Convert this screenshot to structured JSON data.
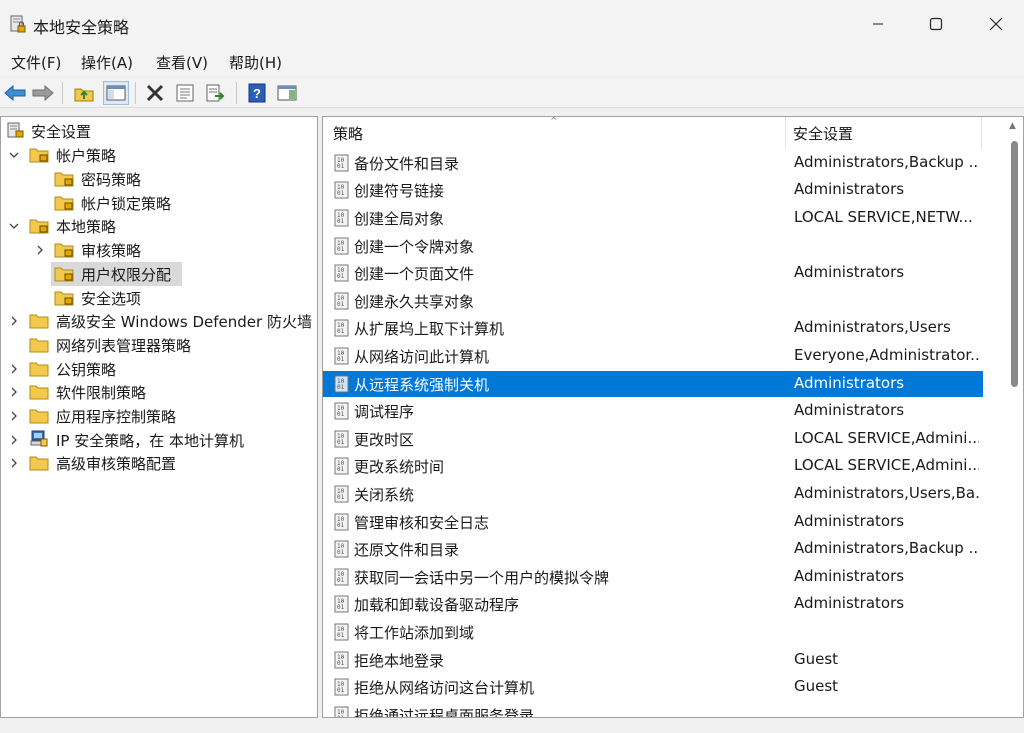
{
  "window": {
    "title": "本地安全策略",
    "minimize": "—",
    "maximize": "☐",
    "close": "✕"
  },
  "menu": [
    {
      "label": "文件(F)"
    },
    {
      "label": "操作(A)"
    },
    {
      "label": "查看(V)"
    },
    {
      "label": "帮助(H)"
    }
  ],
  "toolbar": {
    "icons": [
      "back-arrow-icon",
      "forward-arrow-icon",
      "up-folder-icon",
      "show-hide-tree-icon",
      "delete-icon",
      "properties-icon",
      "export-list-icon",
      "help-icon",
      "show-action-pane-icon"
    ]
  },
  "tree": [
    {
      "label": "安全设置",
      "level": 0,
      "expander": "",
      "icon": "security-settings-icon"
    },
    {
      "label": "帐户策略",
      "level": 1,
      "expander": "expanded",
      "icon": "folder-lock-icon"
    },
    {
      "label": "密码策略",
      "level": 2,
      "expander": "",
      "icon": "folder-lock-icon"
    },
    {
      "label": "帐户锁定策略",
      "level": 2,
      "expander": "",
      "icon": "folder-lock-icon"
    },
    {
      "label": "本地策略",
      "level": 1,
      "expander": "expanded",
      "icon": "folder-lock-icon"
    },
    {
      "label": "审核策略",
      "level": 2,
      "expander": "collapsed",
      "icon": "folder-lock-icon"
    },
    {
      "label": "用户权限分配",
      "level": 2,
      "expander": "",
      "icon": "folder-lock-icon",
      "selected": true
    },
    {
      "label": "安全选项",
      "level": 2,
      "expander": "",
      "icon": "folder-lock-icon"
    },
    {
      "label": "高级安全 Windows Defender 防火墙",
      "level": 1,
      "expander": "collapsed",
      "icon": "folder-icon"
    },
    {
      "label": "网络列表管理器策略",
      "level": 1,
      "expander": "",
      "icon": "folder-icon"
    },
    {
      "label": "公钥策略",
      "level": 1,
      "expander": "collapsed",
      "icon": "folder-icon"
    },
    {
      "label": "软件限制策略",
      "level": 1,
      "expander": "collapsed",
      "icon": "folder-icon"
    },
    {
      "label": "应用程序控制策略",
      "level": 1,
      "expander": "collapsed",
      "icon": "folder-icon"
    },
    {
      "label": "IP 安全策略，在 本地计算机",
      "level": 1,
      "expander": "collapsed",
      "icon": "ip-security-icon"
    },
    {
      "label": "高级审核策略配置",
      "level": 1,
      "expander": "collapsed",
      "icon": "folder-icon"
    }
  ],
  "list": {
    "columns": {
      "policy": "策略",
      "setting": "安全设置"
    },
    "rows": [
      {
        "policy": "备份文件和目录",
        "setting": "Administrators,Backup ..."
      },
      {
        "policy": "创建符号链接",
        "setting": "Administrators"
      },
      {
        "policy": "创建全局对象",
        "setting": "LOCAL SERVICE,NETW..."
      },
      {
        "policy": "创建一个令牌对象",
        "setting": ""
      },
      {
        "policy": "创建一个页面文件",
        "setting": "Administrators"
      },
      {
        "policy": "创建永久共享对象",
        "setting": ""
      },
      {
        "policy": "从扩展坞上取下计算机",
        "setting": "Administrators,Users"
      },
      {
        "policy": "从网络访问此计算机",
        "setting": "Everyone,Administrator..."
      },
      {
        "policy": "从远程系统强制关机",
        "setting": "Administrators",
        "selected": true
      },
      {
        "policy": "调试程序",
        "setting": "Administrators"
      },
      {
        "policy": "更改时区",
        "setting": "LOCAL SERVICE,Admini..."
      },
      {
        "policy": "更改系统时间",
        "setting": "LOCAL SERVICE,Admini..."
      },
      {
        "policy": "关闭系统",
        "setting": "Administrators,Users,Ba..."
      },
      {
        "policy": "管理审核和安全日志",
        "setting": "Administrators"
      },
      {
        "policy": "还原文件和目录",
        "setting": "Administrators,Backup ..."
      },
      {
        "policy": "获取同一会话中另一个用户的模拟令牌",
        "setting": "Administrators"
      },
      {
        "policy": "加载和卸载设备驱动程序",
        "setting": "Administrators"
      },
      {
        "policy": "将工作站添加到域",
        "setting": ""
      },
      {
        "policy": "拒绝本地登录",
        "setting": "Guest"
      },
      {
        "policy": "拒绝从网络访问这台计算机",
        "setting": "Guest"
      },
      {
        "policy": "拒绝通过远程桌面服务登录",
        "setting": ""
      }
    ]
  },
  "colors": {
    "selection": "#0078d7",
    "tree_selection": "#d9d9d9",
    "folder": "#f2c94c"
  }
}
